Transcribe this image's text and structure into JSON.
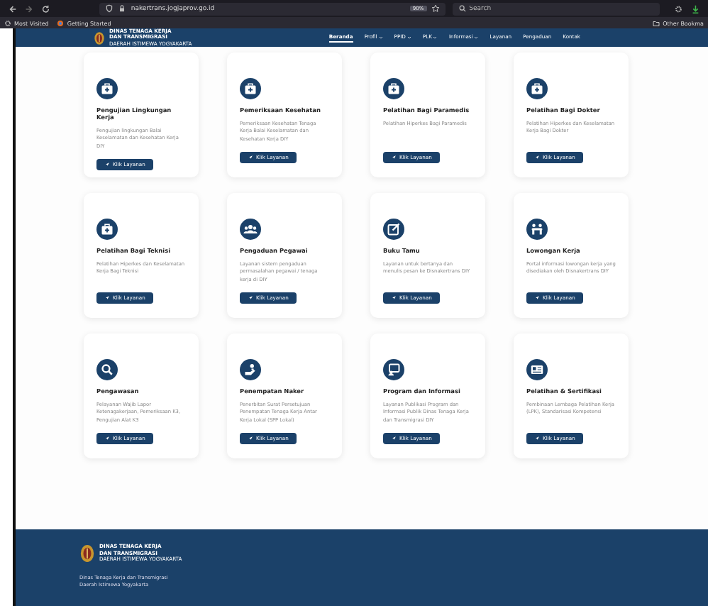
{
  "browser": {
    "url": "nakertrans.jogjaprov.go.id",
    "zoom": "90%",
    "search_placeholder": "Search",
    "bookmarks": [
      "Most Visited",
      "Getting Started"
    ],
    "other_bookmarks": "Other Bookma"
  },
  "site": {
    "logo_lines": [
      "DINAS TENAGA KERJA",
      "DAN TRANSMIGRASI",
      "DAERAH ISTIMEWA YOGYAKARTA"
    ],
    "nav": [
      {
        "label": "Beranda",
        "dropdown": false,
        "selected": true
      },
      {
        "label": "Profil",
        "dropdown": true,
        "selected": false
      },
      {
        "label": "PPID",
        "dropdown": true,
        "selected": false
      },
      {
        "label": "PLK",
        "dropdown": true,
        "selected": false
      },
      {
        "label": "Informasi",
        "dropdown": true,
        "selected": false
      },
      {
        "label": "Layanan",
        "dropdown": false,
        "selected": false
      },
      {
        "label": "Pengaduan",
        "dropdown": false,
        "selected": false
      },
      {
        "label": "Kontak",
        "dropdown": false,
        "selected": false
      }
    ]
  },
  "services": [
    {
      "title": "Pengujian Lingkungan Kerja",
      "description": "Pengujian lingkungan Balai Keselamatan dan Kesehatan Kerja DIY",
      "button": "Klik Layanan"
    },
    {
      "title": "Pemeriksaan Kesehatan",
      "description": "Pemeriksaan Kesehatan Tenaga Kerja Balai Keselamatan dan Kesehatan Kerja DIY",
      "button": "Klik Layanan"
    },
    {
      "title": "Pelatihan Bagi Paramedis",
      "description": "Pelatihan Hiperkes Bagi Paramedis",
      "button": "Klik Layanan"
    },
    {
      "title": "Pelatihan Bagi Dokter",
      "description": "Pelatihan Hiperkes dan Keselamatan Kerja Bagi Dokter",
      "button": "Klik Layanan"
    },
    {
      "title": "Pelatihan Bagi Teknisi",
      "description": "Pelatihan Hiperkes dan Keselamatan Kerja Bagi Teknisi",
      "button": "Klik Layanan"
    },
    {
      "title": "Pengaduan Pegawai",
      "description": "Layanan sistem pengaduan permasalahan pegawai / tenaga kerja di DIY",
      "button": "Klik Layanan"
    },
    {
      "title": "Buku Tamu",
      "description": "Layanan untuk bertanya dan menulis pesan ke Disnakertrans DIY",
      "button": "Klik Layanan"
    },
    {
      "title": "Lowongan Kerja",
      "description": "Portal informasi lowongan kerja yang disediakan oleh Disnakertrans DIY",
      "button": "Klik Layanan"
    },
    {
      "title": "Pengawasan",
      "description": "Pelayanan Wajib Lapor Ketenagakerjaan, Pemeriksaan K3, Pengujian Alat K3",
      "button": "Klik Layanan"
    },
    {
      "title": "Penempatan Naker",
      "description": "Penerbitan Surat Persetujuan Penempatan Tenaga Kerja Antar Kerja Lokal (SPP Lokal)",
      "button": "Klik Layanan"
    },
    {
      "title": "Program dan Informasi",
      "description": "Layanan Publikasi Program dan Informasi Publik Dinas Tenaga Kerja dan Transmigrasi DIY",
      "button": "Klik Layanan"
    },
    {
      "title": "Pelatihan & Sertifikasi",
      "description": "Pembinaan Lembaga Pelatihan Kerja (LPK), Standarisasi Kompetensi",
      "button": "Klik Layanan"
    }
  ],
  "footer": {
    "logo_lines": [
      "DINAS TENAGA KERJA",
      "DAN TRANSMIGRASI",
      "DAERAH ISTIMEWA YOGYAKARTA"
    ],
    "address_lines": [
      "Dinas Tenaga Kerja dan Transmigrasi",
      "Daerah Istimewa Yogyakarta"
    ]
  }
}
